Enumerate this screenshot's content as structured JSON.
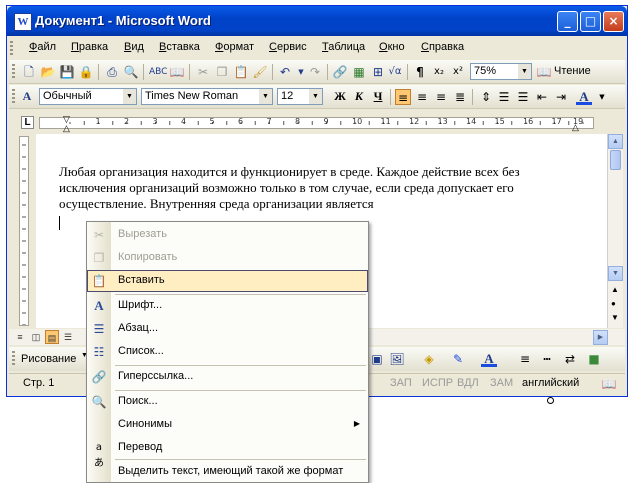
{
  "window": {
    "title": "Документ1 - Microsoft Word",
    "app_icon": "W"
  },
  "title_buttons": {
    "minimize": "_",
    "maximize": "□",
    "close": "×"
  },
  "menubar": {
    "items": [
      "Файл",
      "Правка",
      "Вид",
      "Вставка",
      "Формат",
      "Сервис",
      "Таблица",
      "Окно",
      "Справка"
    ]
  },
  "standard_toolbar": {
    "zoom": "75%",
    "reading_button": "Чтение"
  },
  "format_toolbar": {
    "style": "Обычный",
    "font": "Times New Roman",
    "size": "12",
    "bold": "Ж",
    "italic": "К",
    "underline": "Ч"
  },
  "ruler": {
    "marks": [
      "1",
      "2",
      "3",
      "4",
      "5",
      "6",
      "7",
      "8",
      "9",
      "10",
      "11",
      "12",
      "13",
      "14",
      "15",
      "16",
      "17",
      "19"
    ]
  },
  "document": {
    "text": "Любая организация находится и функционирует в среде. Каждое действие всех без исключения организаций возможно только в том случае, если среда допускает его осуществление. Внутренняя среда организации является"
  },
  "drawing_toolbar": {
    "draw_label": "Рисование"
  },
  "statusbar": {
    "page": "Стр. 1",
    "rec": "ЗАП",
    "trk": "ИСПР",
    "ext": "ВДЛ",
    "ovr": "ЗАМ",
    "language": "английский"
  },
  "context_menu": {
    "items": [
      {
        "label": "Вырезать",
        "icon": "scissors-icon",
        "disabled": true
      },
      {
        "label": "Копировать",
        "icon": "copy-icon",
        "disabled": true
      },
      {
        "label": "Вставить",
        "icon": "paste-icon",
        "highlighted": true
      },
      {
        "label": "Шрифт...",
        "icon": "font-icon"
      },
      {
        "label": "Абзац...",
        "icon": "paragraph-icon"
      },
      {
        "label": "Список...",
        "icon": "list-icon"
      },
      {
        "label": "Гиперссылка...",
        "icon": "hyperlink-icon"
      },
      {
        "label": "Поиск...",
        "icon": "search-icon"
      },
      {
        "label": "Синонимы",
        "icon": "",
        "submenu": true
      },
      {
        "label": "Перевод",
        "icon": "translate-icon"
      },
      {
        "label": "Выделить текст, имеющий такой же формат",
        "icon": ""
      }
    ]
  },
  "colors": {
    "title_bar": "#0a5be8",
    "menu_highlight": "#ffeec2",
    "window_bg": "#ece9d8"
  }
}
